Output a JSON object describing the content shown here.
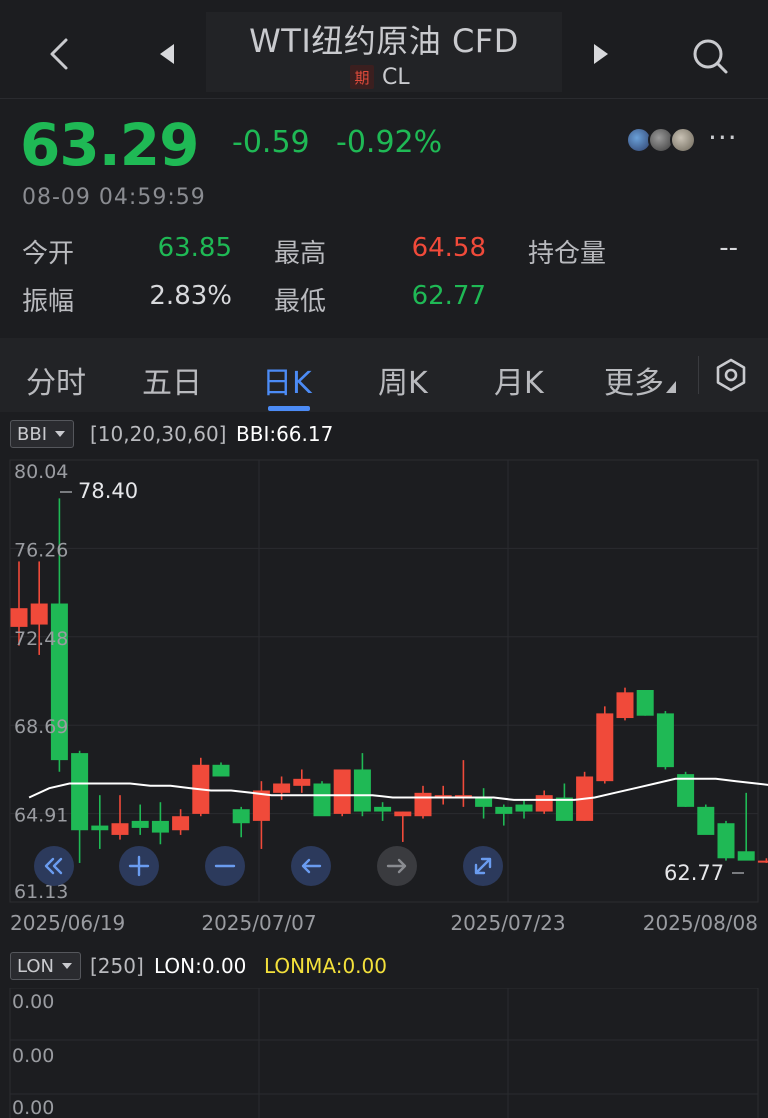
{
  "header": {
    "title": "WTI纽约原油 CFD",
    "badge": "期",
    "symbol": "CL",
    "back_icon": "chevron-left-icon",
    "prev_icon": "triangle-left-icon",
    "next_icon": "triangle-right-icon",
    "search_icon": "search-icon"
  },
  "quote": {
    "price": "63.29",
    "change": "-0.59",
    "change_pct": "-0.92%",
    "timestamp": "08-09 04:59:59",
    "more_label": "···",
    "stats": {
      "open_label": "今开",
      "open_value": "63.85",
      "high_label": "最高",
      "high_value": "64.58",
      "oi_label": "持仓量",
      "oi_value": "--",
      "amp_label": "振幅",
      "amp_value": "2.83%",
      "low_label": "最低",
      "low_value": "62.77"
    },
    "colors": {
      "up": "#f04a3a",
      "down": "#1fb955"
    }
  },
  "tabs": {
    "items": [
      "分时",
      "五日",
      "日K",
      "周K",
      "月K",
      "更多"
    ],
    "active": "日K"
  },
  "main_indicator": {
    "name": "BBI",
    "params": "[10,20,30,60]",
    "value_label": "BBI:66.17"
  },
  "sub_indicator": {
    "name": "LON",
    "params": "[250]",
    "value_label": "LON:0.00",
    "ma_label": "LONMA:0.00",
    "y_ticks": [
      "0.00",
      "0.00",
      "0.00"
    ]
  },
  "chart_controls": [
    "double-left-icon",
    "zoom-in-icon",
    "zoom-out-icon",
    "arrow-left-icon",
    "arrow-right-icon",
    "reset-zoom-icon"
  ],
  "chart_data": {
    "type": "candlestick",
    "y_ticks": [
      "80.04",
      "76.26",
      "72.48",
      "68.69",
      "64.91",
      "61.13"
    ],
    "ylim": [
      61.13,
      80.04
    ],
    "x_ticks": [
      "2025/06/19",
      "2025/07/07",
      "2025/07/23",
      "2025/08/08"
    ],
    "max_label": "78.40",
    "min_label": "62.77",
    "up_color": "#f04a3a",
    "down_color": "#1fb955",
    "bbi_color": "#ffffff",
    "candles": [
      {
        "o": 72.9,
        "h": 75.7,
        "l": 72.1,
        "c": 73.7
      },
      {
        "o": 73.0,
        "h": 75.7,
        "l": 71.7,
        "c": 73.9
      },
      {
        "o": 73.9,
        "h": 78.4,
        "l": 66.7,
        "c": 67.2
      },
      {
        "o": 67.5,
        "h": 67.6,
        "l": 62.8,
        "c": 64.2
      },
      {
        "o": 64.4,
        "h": 65.7,
        "l": 63.4,
        "c": 64.2
      },
      {
        "o": 64.0,
        "h": 65.7,
        "l": 63.8,
        "c": 64.5
      },
      {
        "o": 64.6,
        "h": 65.3,
        "l": 64.0,
        "c": 64.3
      },
      {
        "o": 64.6,
        "h": 65.4,
        "l": 63.6,
        "c": 64.1
      },
      {
        "o": 64.2,
        "h": 65.1,
        "l": 64.0,
        "c": 64.8
      },
      {
        "o": 64.9,
        "h": 67.3,
        "l": 64.8,
        "c": 67.0
      },
      {
        "o": 67.0,
        "h": 67.1,
        "l": 66.5,
        "c": 66.5
      },
      {
        "o": 65.1,
        "h": 65.2,
        "l": 63.9,
        "c": 64.5
      },
      {
        "o": 64.6,
        "h": 66.3,
        "l": 63.4,
        "c": 65.9
      },
      {
        "o": 65.8,
        "h": 66.5,
        "l": 65.5,
        "c": 66.2
      },
      {
        "o": 66.1,
        "h": 66.8,
        "l": 65.8,
        "c": 66.4
      },
      {
        "o": 66.2,
        "h": 66.3,
        "l": 64.9,
        "c": 64.8
      },
      {
        "o": 64.9,
        "h": 66.7,
        "l": 64.8,
        "c": 66.8
      },
      {
        "o": 66.8,
        "h": 67.5,
        "l": 64.8,
        "c": 65.0
      },
      {
        "o": 65.2,
        "h": 65.4,
        "l": 64.6,
        "c": 65.0
      },
      {
        "o": 64.8,
        "h": 65.0,
        "l": 63.7,
        "c": 65.0
      },
      {
        "o": 64.8,
        "h": 66.1,
        "l": 64.7,
        "c": 65.8
      },
      {
        "o": 65.7,
        "h": 66.1,
        "l": 65.3,
        "c": 65.7
      },
      {
        "o": 65.7,
        "h": 67.2,
        "l": 65.2,
        "c": 65.7
      },
      {
        "o": 65.6,
        "h": 66.0,
        "l": 64.7,
        "c": 65.2
      },
      {
        "o": 65.2,
        "h": 65.3,
        "l": 64.4,
        "c": 64.9
      },
      {
        "o": 65.3,
        "h": 65.5,
        "l": 64.7,
        "c": 65.0
      },
      {
        "o": 65.0,
        "h": 65.9,
        "l": 64.9,
        "c": 65.7
      },
      {
        "o": 65.6,
        "h": 66.2,
        "l": 64.8,
        "c": 64.6
      },
      {
        "o": 64.6,
        "h": 66.7,
        "l": 64.6,
        "c": 66.5
      },
      {
        "o": 66.3,
        "h": 69.5,
        "l": 66.2,
        "c": 69.2
      },
      {
        "o": 69.0,
        "h": 70.3,
        "l": 68.9,
        "c": 70.1
      },
      {
        "o": 70.2,
        "h": 70.2,
        "l": 69.1,
        "c": 69.1
      },
      {
        "o": 69.2,
        "h": 69.3,
        "l": 66.8,
        "c": 66.9
      },
      {
        "o": 66.6,
        "h": 66.7,
        "l": 65.2,
        "c": 65.2
      },
      {
        "o": 65.2,
        "h": 65.3,
        "l": 64.1,
        "c": 64.0
      },
      {
        "o": 64.5,
        "h": 64.6,
        "l": 62.9,
        "c": 63.0
      },
      {
        "o": 63.3,
        "h": 65.8,
        "l": 63.0,
        "c": 62.9
      },
      {
        "o": 62.9,
        "h": 63.0,
        "l": 62.8,
        "c": 62.9
      }
    ],
    "bbi": [
      65.6,
      66.0,
      66.2,
      66.2,
      66.2,
      66.2,
      66.1,
      66.1,
      66.0,
      65.9,
      65.9,
      65.8,
      65.7,
      65.7,
      65.7,
      65.7,
      65.7,
      65.7,
      65.6,
      65.6,
      65.6,
      65.6,
      65.6,
      65.6,
      65.5,
      65.5,
      65.5,
      65.5,
      65.6,
      65.8,
      66.0,
      66.2,
      66.4,
      66.4,
      66.4,
      66.3,
      66.2,
      66.1
    ]
  }
}
